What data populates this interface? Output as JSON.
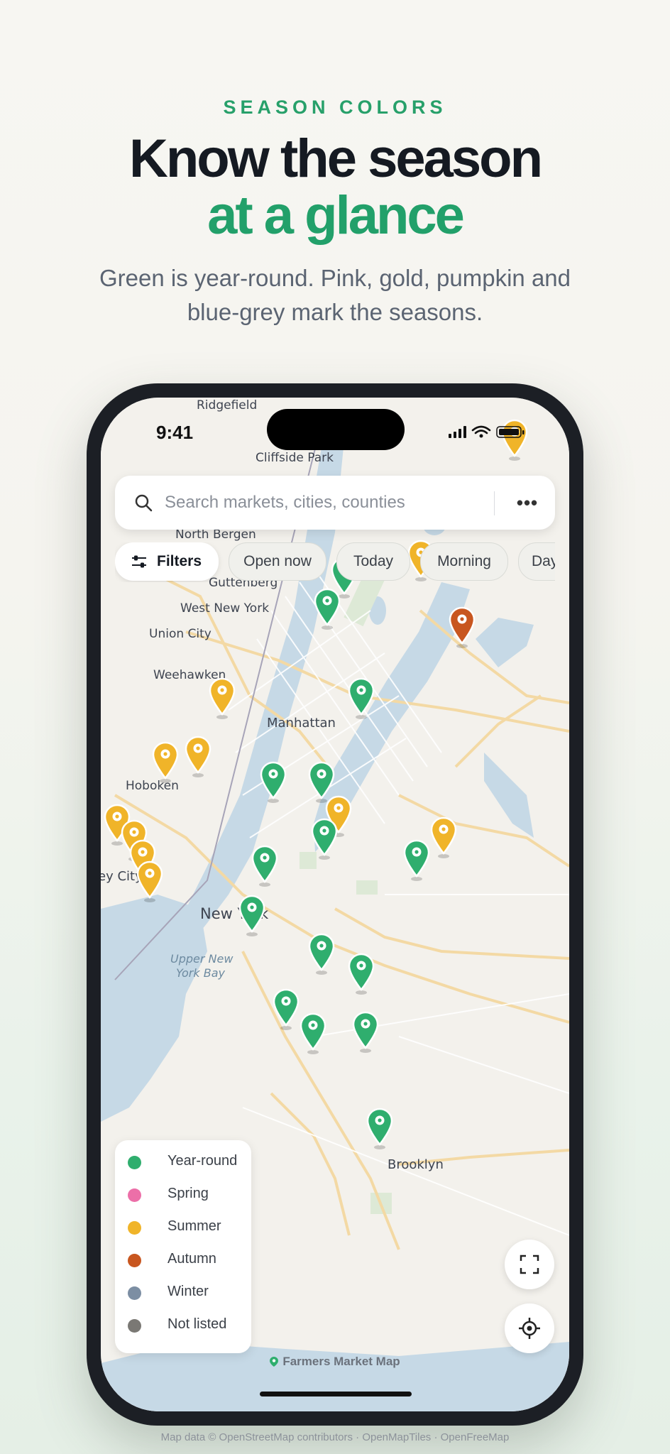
{
  "header": {
    "eyebrow": "SEASON COLORS",
    "title_line1": "Know the season",
    "title_line2": "at a glance",
    "subtitle": "Green is year-round. Pink, gold, pumpkin and blue-grey mark the seasons."
  },
  "status_bar": {
    "time": "9:41"
  },
  "search": {
    "placeholder": "Search markets, cities, counties",
    "more_label": "•••"
  },
  "chips": [
    {
      "label": "Filters"
    },
    {
      "label": "Open now"
    },
    {
      "label": "Today"
    },
    {
      "label": "Morning"
    },
    {
      "label": "Day"
    }
  ],
  "map_labels": [
    "Ridgefield",
    "Cliffside Park",
    "North Bergen",
    "Guttenberg",
    "West New York",
    "Union City",
    "Weehawken",
    "Manhattan",
    "Hoboken",
    "New York",
    "Upper New",
    "York Bay",
    "Brooklyn",
    "ey City"
  ],
  "legend": [
    {
      "label": "Year-round",
      "color": "#2fae6e"
    },
    {
      "label": "Spring",
      "color": "#ec6fa8"
    },
    {
      "label": "Summer",
      "color": "#f0b429"
    },
    {
      "label": "Autumn",
      "color": "#c8561f"
    },
    {
      "label": "Winter",
      "color": "#7c8ea3"
    },
    {
      "label": "Not listed",
      "color": "#7a7874"
    }
  ],
  "markers": [
    {
      "season": "summer"
    },
    {
      "season": "summer"
    },
    {
      "season": "summer"
    },
    {
      "season": "summer"
    },
    {
      "season": "year-round"
    },
    {
      "season": "year-round"
    },
    {
      "season": "autumn"
    },
    {
      "season": "year-round"
    },
    {
      "season": "summer"
    },
    {
      "season": "summer"
    },
    {
      "season": "year-round"
    },
    {
      "season": "year-round"
    },
    {
      "season": "summer"
    },
    {
      "season": "year-round"
    },
    {
      "season": "summer"
    },
    {
      "season": "year-round"
    },
    {
      "season": "summer"
    },
    {
      "season": "summer"
    },
    {
      "season": "summer"
    },
    {
      "season": "year-round"
    },
    {
      "season": "year-round"
    },
    {
      "season": "year-round"
    },
    {
      "season": "year-round"
    },
    {
      "season": "year-round"
    },
    {
      "season": "year-round"
    },
    {
      "season": "year-round"
    },
    {
      "season": "year-round"
    }
  ],
  "brand": "Farmers Market Map",
  "attribution": "Map data © OpenStreetMap contributors · OpenMapTiles · OpenFreeMap"
}
